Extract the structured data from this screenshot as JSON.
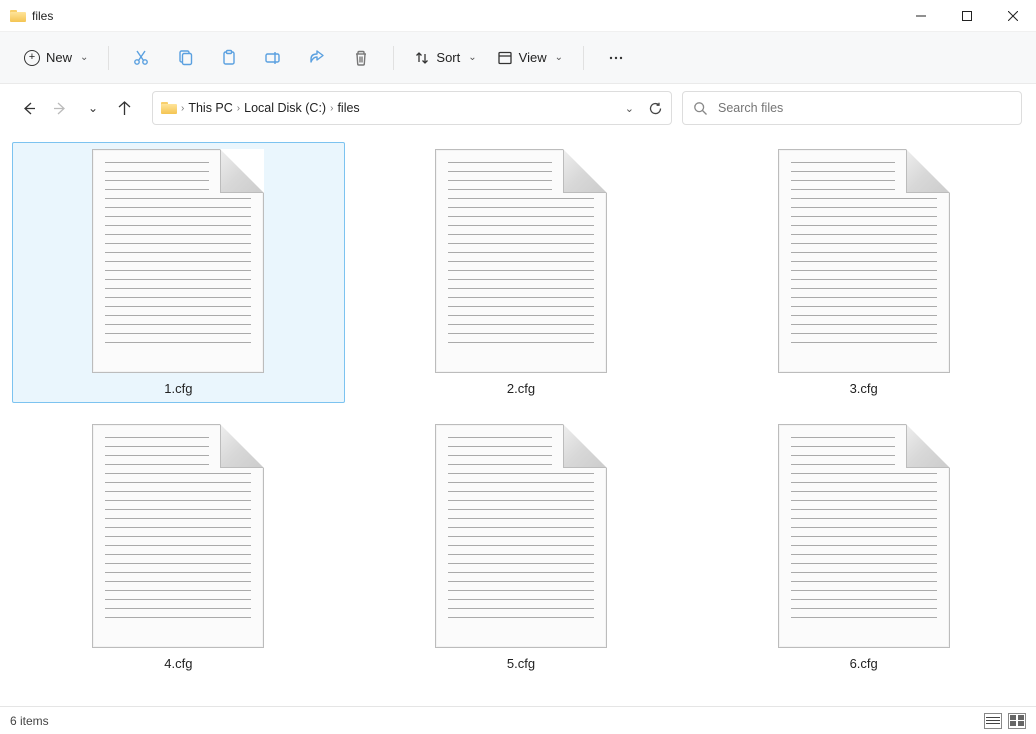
{
  "window": {
    "title": "files"
  },
  "toolbar": {
    "new_label": "New",
    "sort_label": "Sort",
    "view_label": "View"
  },
  "breadcrumb": {
    "items": [
      "This PC",
      "Local Disk (C:)",
      "files"
    ]
  },
  "search": {
    "placeholder": "Search files"
  },
  "files": [
    {
      "name": "1.cfg",
      "selected": true
    },
    {
      "name": "2.cfg",
      "selected": false
    },
    {
      "name": "3.cfg",
      "selected": false
    },
    {
      "name": "4.cfg",
      "selected": false
    },
    {
      "name": "5.cfg",
      "selected": false
    },
    {
      "name": "6.cfg",
      "selected": false
    }
  ],
  "status": {
    "text": "6 items"
  }
}
